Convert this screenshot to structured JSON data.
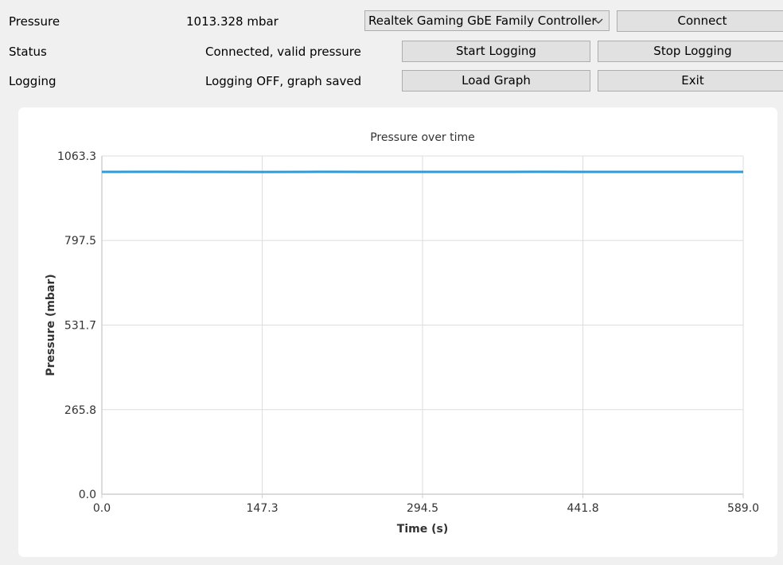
{
  "header": {
    "pressure_label": "Pressure",
    "pressure_value": "1013.328 mbar",
    "status_label": "Status",
    "status_value": "Connected, valid pressure",
    "logging_label": "Logging",
    "logging_value": "Logging OFF, graph saved"
  },
  "adapter_select": {
    "selected": "Realtek Gaming GbE Family Controller",
    "icon": "chevron-down-icon"
  },
  "buttons": {
    "connect": "Connect",
    "start_logging": "Start Logging",
    "stop_logging": "Stop Logging",
    "load_graph": "Load Graph",
    "exit": "Exit"
  },
  "chart_data": {
    "type": "line",
    "title": "Pressure over time",
    "xlabel": "Time (s)",
    "ylabel": "Pressure (mbar)",
    "xlim": [
      0,
      589
    ],
    "ylim": [
      0,
      1063.3
    ],
    "x_ticks": [
      "0.0",
      "147.3",
      "294.5",
      "441.8",
      "589.0"
    ],
    "y_ticks": [
      "0.0",
      "265.8",
      "531.7",
      "797.5",
      "1063.3"
    ],
    "grid": true,
    "line_color": "#2d9cdb",
    "series": [
      {
        "x": [
          0,
          50,
          100,
          147.3,
          200,
          250,
          294.5,
          350,
          400,
          441.8,
          500,
          550,
          589
        ],
        "y": [
          1013.2,
          1013.5,
          1013.3,
          1013.1,
          1013.4,
          1013.3,
          1013.2,
          1013.3,
          1013.4,
          1013.3,
          1013.2,
          1013.3,
          1013.3
        ]
      }
    ]
  }
}
